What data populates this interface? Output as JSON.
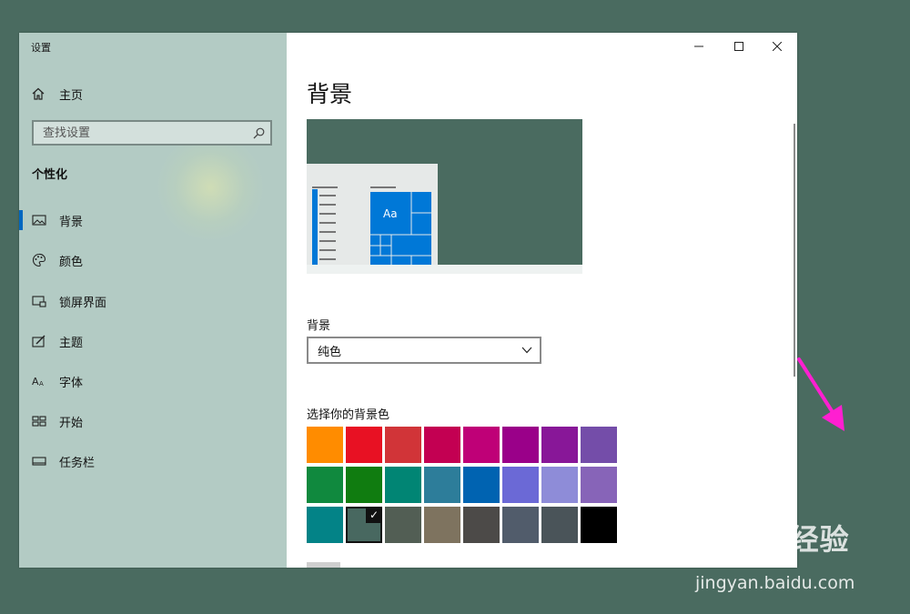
{
  "window": {
    "app_title": "设置",
    "controls": {
      "minimize": "–",
      "maximize": "☐",
      "close": "✕"
    }
  },
  "sidebar": {
    "home_label": "主页",
    "search_placeholder": "查找设置",
    "section_title": "个性化",
    "items": [
      {
        "label": "背景",
        "icon": "picture-icon",
        "active": true
      },
      {
        "label": "颜色",
        "icon": "palette-icon",
        "active": false
      },
      {
        "label": "锁屏界面",
        "icon": "lock-screen-icon",
        "active": false
      },
      {
        "label": "主题",
        "icon": "theme-icon",
        "active": false
      },
      {
        "label": "字体",
        "icon": "font-icon",
        "active": false
      },
      {
        "label": "开始",
        "icon": "start-icon",
        "active": false
      },
      {
        "label": "任务栏",
        "icon": "taskbar-icon",
        "active": false
      }
    ]
  },
  "main": {
    "page_title": "背景",
    "preview_tile_text": "Aa",
    "background_label": "背景",
    "background_value": "纯色",
    "swatch_title": "选择你的背景色",
    "swatch_colors": [
      "#ff8c00",
      "#e81123",
      "#d13438",
      "#c30052",
      "#bf0077",
      "#9a0089",
      "#881798",
      "#744da9",
      "#10893e",
      "#107c10",
      "#018574",
      "#2d7d9a",
      "#0063b1",
      "#6b69d6",
      "#8e8cd8",
      "#8764b8",
      "#038387",
      "#486860",
      "#525e54",
      "#7e735f",
      "#4c4a48",
      "#515c6b",
      "#4a5459",
      "#000000"
    ],
    "selected_swatch": 17,
    "accent": "#0067c0",
    "desktop_color": "#4a6b60"
  },
  "watermark": {
    "brand": "Baidu经验",
    "url": "jingyan.baidu.com"
  }
}
